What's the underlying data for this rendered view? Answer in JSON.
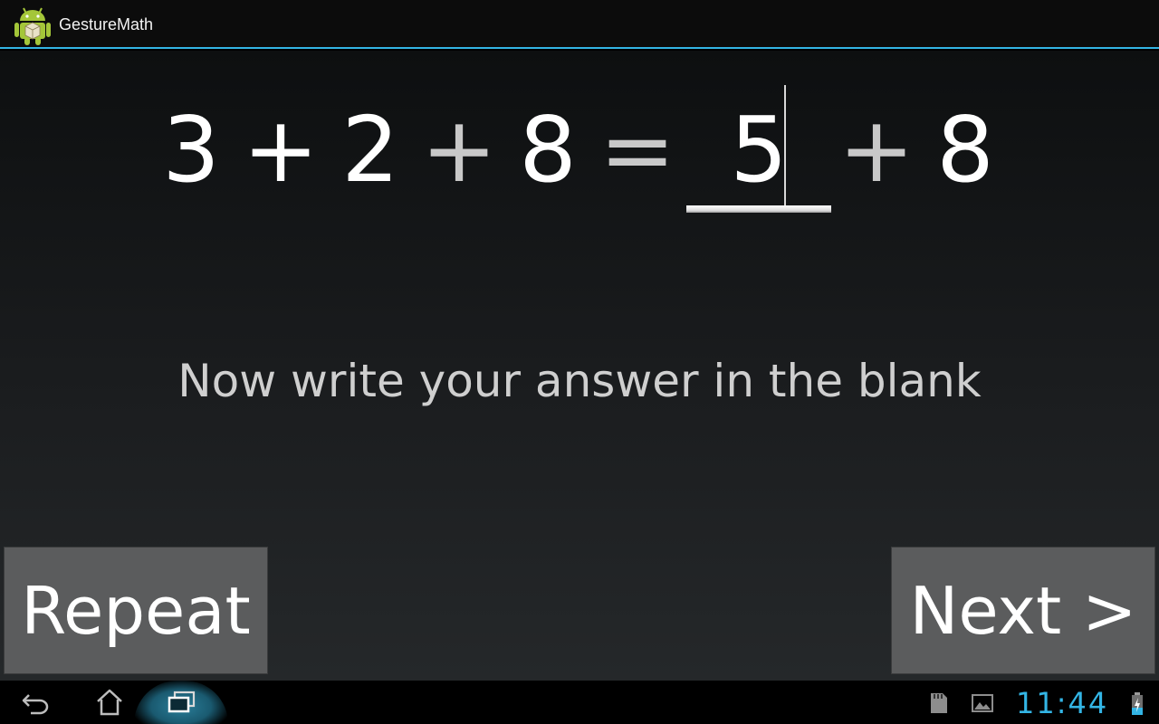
{
  "app": {
    "title": "GestureMath"
  },
  "equation": {
    "left": [
      {
        "text": "3",
        "kind": "number"
      },
      {
        "text": "+",
        "kind": "operator"
      },
      {
        "text": "2",
        "kind": "number"
      },
      {
        "text": "+",
        "kind": "operator"
      },
      {
        "text": "8",
        "kind": "number"
      }
    ],
    "equals": "=",
    "answer_value": "5",
    "right": [
      {
        "text": "+",
        "kind": "operator"
      },
      {
        "text": "8",
        "kind": "number"
      }
    ]
  },
  "instruction": "Now write your answer in the blank",
  "buttons": {
    "repeat": "Repeat",
    "next": "Next >"
  },
  "system_bar": {
    "time": "11:44",
    "icons": [
      "back-icon",
      "home-icon",
      "recent-apps-icon",
      "sd-card-icon",
      "gallery-icon",
      "battery-charging-icon"
    ]
  },
  "colors": {
    "accent": "#33b5e5",
    "button_bg": "#5b5c5d"
  }
}
